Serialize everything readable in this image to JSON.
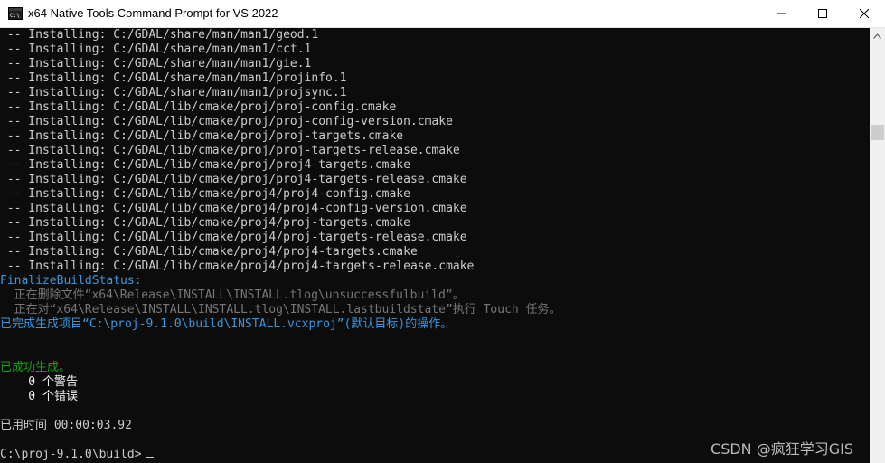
{
  "window": {
    "title": "x64 Native Tools Command Prompt for VS 2022",
    "app_icon": "console-icon",
    "controls": {
      "minimize_icon": "minimize-icon",
      "maximize_icon": "maximize-icon",
      "close_icon": "close-icon"
    }
  },
  "console": {
    "lines": [
      " -- Installing: C:/GDAL/share/man/man1/geod.1",
      " -- Installing: C:/GDAL/share/man/man1/cct.1",
      " -- Installing: C:/GDAL/share/man/man1/gie.1",
      " -- Installing: C:/GDAL/share/man/man1/projinfo.1",
      " -- Installing: C:/GDAL/share/man/man1/projsync.1",
      " -- Installing: C:/GDAL/lib/cmake/proj/proj-config.cmake",
      " -- Installing: C:/GDAL/lib/cmake/proj/proj-config-version.cmake",
      " -- Installing: C:/GDAL/lib/cmake/proj/proj-targets.cmake",
      " -- Installing: C:/GDAL/lib/cmake/proj/proj-targets-release.cmake",
      " -- Installing: C:/GDAL/lib/cmake/proj/proj4-targets.cmake",
      " -- Installing: C:/GDAL/lib/cmake/proj/proj4-targets-release.cmake",
      " -- Installing: C:/GDAL/lib/cmake/proj4/proj4-config.cmake",
      " -- Installing: C:/GDAL/lib/cmake/proj4/proj4-config-version.cmake",
      " -- Installing: C:/GDAL/lib/cmake/proj4/proj-targets.cmake",
      " -- Installing: C:/GDAL/lib/cmake/proj4/proj-targets-release.cmake",
      " -- Installing: C:/GDAL/lib/cmake/proj4/proj4-targets.cmake",
      " -- Installing: C:/GDAL/lib/cmake/proj4/proj4-targets-release.cmake",
      "FinalizeBuildStatus:",
      "  正在删除文件“x64\\Release\\INSTALL\\INSTALL.tlog\\unsuccessfulbuild”。",
      "  正在对“x64\\Release\\INSTALL\\INSTALL.tlog\\INSTALL.lastbuildstate”执行 Touch 任务。",
      "已完成生成项目“C:\\proj-9.1.0\\build\\INSTALL.vcxproj”(默认目标)的操作。",
      "",
      "",
      "已成功生成。",
      "    0 个警告",
      "    0 个错误",
      "",
      "已用时间 00:00:03.92",
      "",
      "C:\\proj-9.1.0\\build>"
    ]
  },
  "watermark": "CSDN @疯狂学习GIS",
  "colors": {
    "background": "#0c0c0c",
    "text_default": "#cccccc",
    "text_dim": "#767676",
    "text_cyan": "#3a96dd",
    "text_green": "#13a10e",
    "titlebar": "#ffffff",
    "scrollbar": "#f0f0f0"
  },
  "scrollbar": {
    "up_icon": "scroll-up-arrow-icon"
  }
}
